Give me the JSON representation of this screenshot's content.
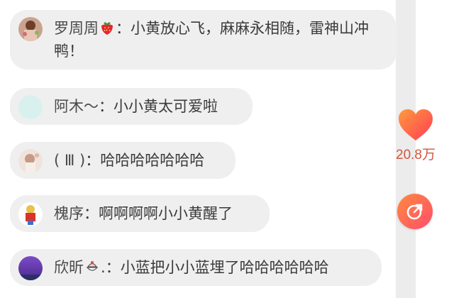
{
  "comments": [
    {
      "user": "罗周周",
      "sep": "：",
      "text": "小黄放心飞，麻麻永相随，雷神山冲鸭！"
    },
    {
      "user": "阿木～",
      "sep": "：",
      "text": "小小黄太可爱啦"
    },
    {
      "user": "( Ⅲ )",
      "sep": "：",
      "text": "哈哈哈哈哈哈哈"
    },
    {
      "user": "槐序",
      "sep": "：",
      "text": "啊啊啊啊小小黄醒了"
    },
    {
      "user": "欣昕",
      "user_suffix": ".",
      "sep": "：",
      "text": "小蓝把小小蓝埋了哈哈哈哈哈哈"
    }
  ],
  "like": {
    "count": "20.8万",
    "icon": "heart-icon",
    "color": "#ff5a4f"
  },
  "share": {
    "icon": "share-arrow-icon"
  },
  "colors": {
    "bubble": "#efefef",
    "text": "#3a3a3a",
    "like_count": "#d2563f"
  }
}
